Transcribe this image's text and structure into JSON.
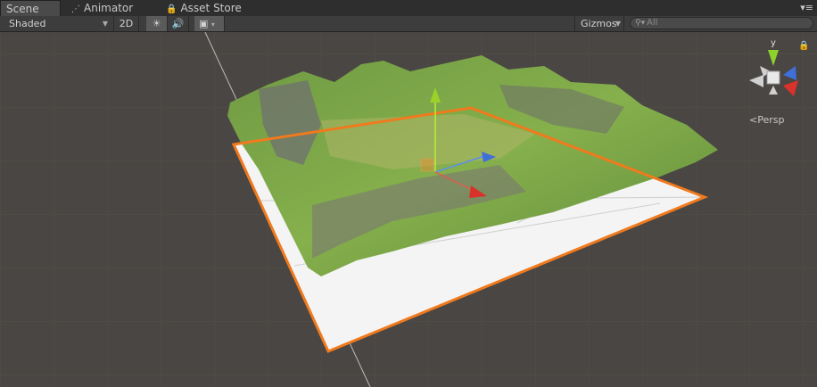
{
  "tabs": [
    {
      "label": "Scene",
      "icon": "scene-icon"
    },
    {
      "label": "Animator",
      "icon": "animator-icon"
    },
    {
      "label": "Asset Store",
      "icon": "store-icon"
    }
  ],
  "toolbar": {
    "draw_mode": "Shaded",
    "mode_2d": "2D",
    "lighting_icon": "sun-icon",
    "audio_icon": "audio-icon",
    "effects_icon": "image-icon",
    "gizmos": "Gizmos",
    "search_placeholder": "All"
  },
  "gizmo": {
    "y_label": "y",
    "projection": "Persp"
  },
  "colors": {
    "selection": "#f07a1d",
    "y_axis": "#9ad22a",
    "x_axis": "#d9322a",
    "z_axis": "#3f6fd8"
  }
}
